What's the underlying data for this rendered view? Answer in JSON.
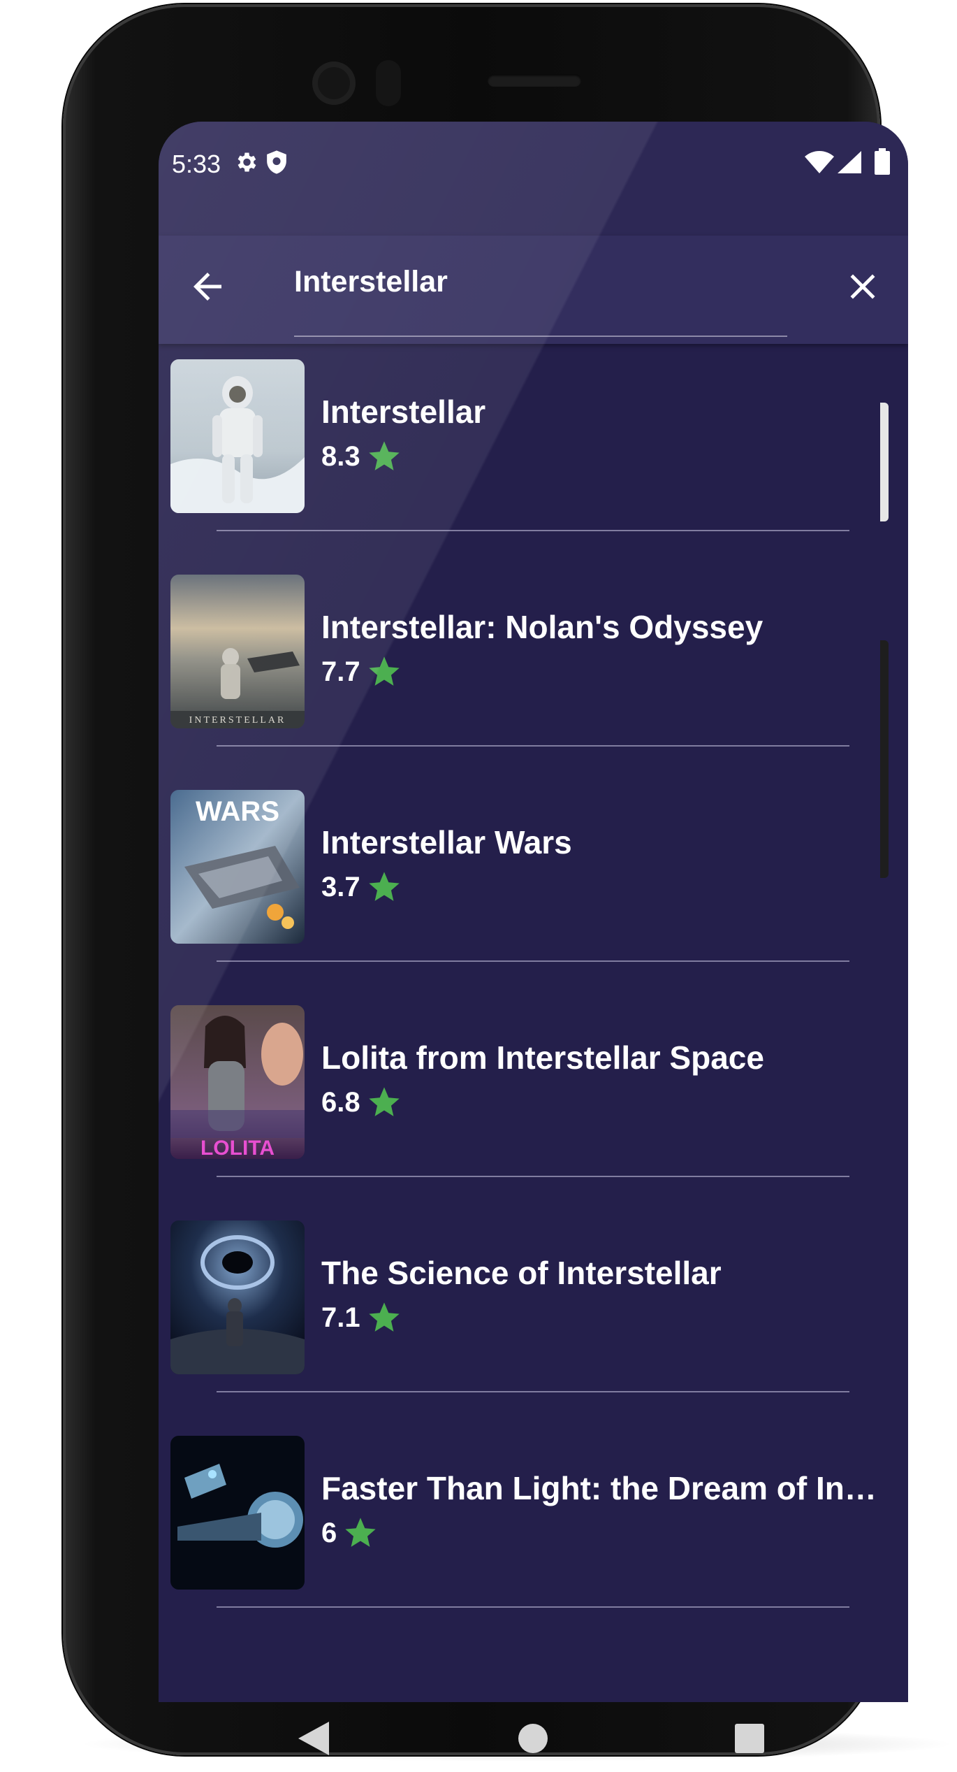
{
  "status_bar": {
    "time": "5:33",
    "icons": [
      "settings-gear-icon",
      "shield-icon",
      "wifi-icon",
      "signal-icon",
      "battery-icon"
    ]
  },
  "search": {
    "value": "Interstellar",
    "back_icon": "arrow-left-icon",
    "clear_icon": "close-icon"
  },
  "results": [
    {
      "title": "Interstellar",
      "rating": "8.3",
      "poster": "astronaut-on-ice-poster"
    },
    {
      "title": "Interstellar: Nolan's Odyssey",
      "rating": "7.7",
      "poster": "astronaut-in-water-poster"
    },
    {
      "title": "Interstellar Wars",
      "rating": "3.7",
      "poster": "spaceship-poster",
      "poster_text": "WARS"
    },
    {
      "title": "Lolita from Interstellar Space",
      "rating": "6.8",
      "poster": "woman-portrait-poster",
      "poster_text": "LOLITA"
    },
    {
      "title": "The Science of Interstellar",
      "rating": "7.1",
      "poster": "black-hole-poster"
    },
    {
      "title": "Faster Than Light: the Dream of Interstellar Flight",
      "rating": "6",
      "poster": "space-station-poster"
    }
  ],
  "rating_icon": "star-icon",
  "nav_bar": [
    "back-triangle-icon",
    "home-circle-icon",
    "recents-square-icon"
  ],
  "colors": {
    "background": "#241f4b",
    "app_bar": "#332e5e",
    "star": "#4caf50",
    "text": "#ffffff"
  }
}
